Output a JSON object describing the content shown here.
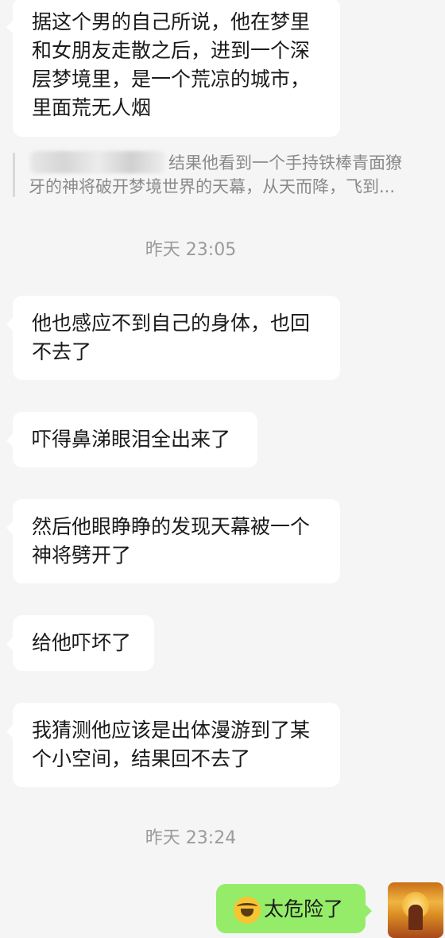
{
  "messages": [
    {
      "id": "m1",
      "text": "据这个男的自己所说，他在梦里\n和女朋友走散之后，进到一个深\n层梦境里，是一个荒凉的城市，\n里面荒无人烟"
    },
    {
      "id": "m2",
      "text": "他也感应不到自己的身体，也回\n不去了"
    },
    {
      "id": "m3",
      "text": "吓得鼻涕眼泪全出来了"
    },
    {
      "id": "m4",
      "text": "然后他眼睁睁的发现天幕被一个\n神将劈开了"
    },
    {
      "id": "m5",
      "text": "给他吓坏了"
    },
    {
      "id": "m6",
      "text": "我猜测他应该是出体漫游到了某\n个小空间，结果回不去了"
    }
  ],
  "quote": {
    "text": "结果他看到一个手持铁棒青面獠",
    "text2": "牙的神将破开梦境世界的天幕，从天而降，飞到..."
  },
  "timestamps": {
    "t1": "昨天 23:05",
    "t2": "昨天 23:24"
  },
  "outgoing": {
    "emoji": "loudly-crying-emoji",
    "text": "太危险了"
  },
  "colors": {
    "background": "#f5f5f5",
    "incoming_bubble": "#ffffff",
    "outgoing_bubble": "#95ec69",
    "timestamp": "#9b9b9b",
    "quote_text": "#8a8a8a"
  }
}
